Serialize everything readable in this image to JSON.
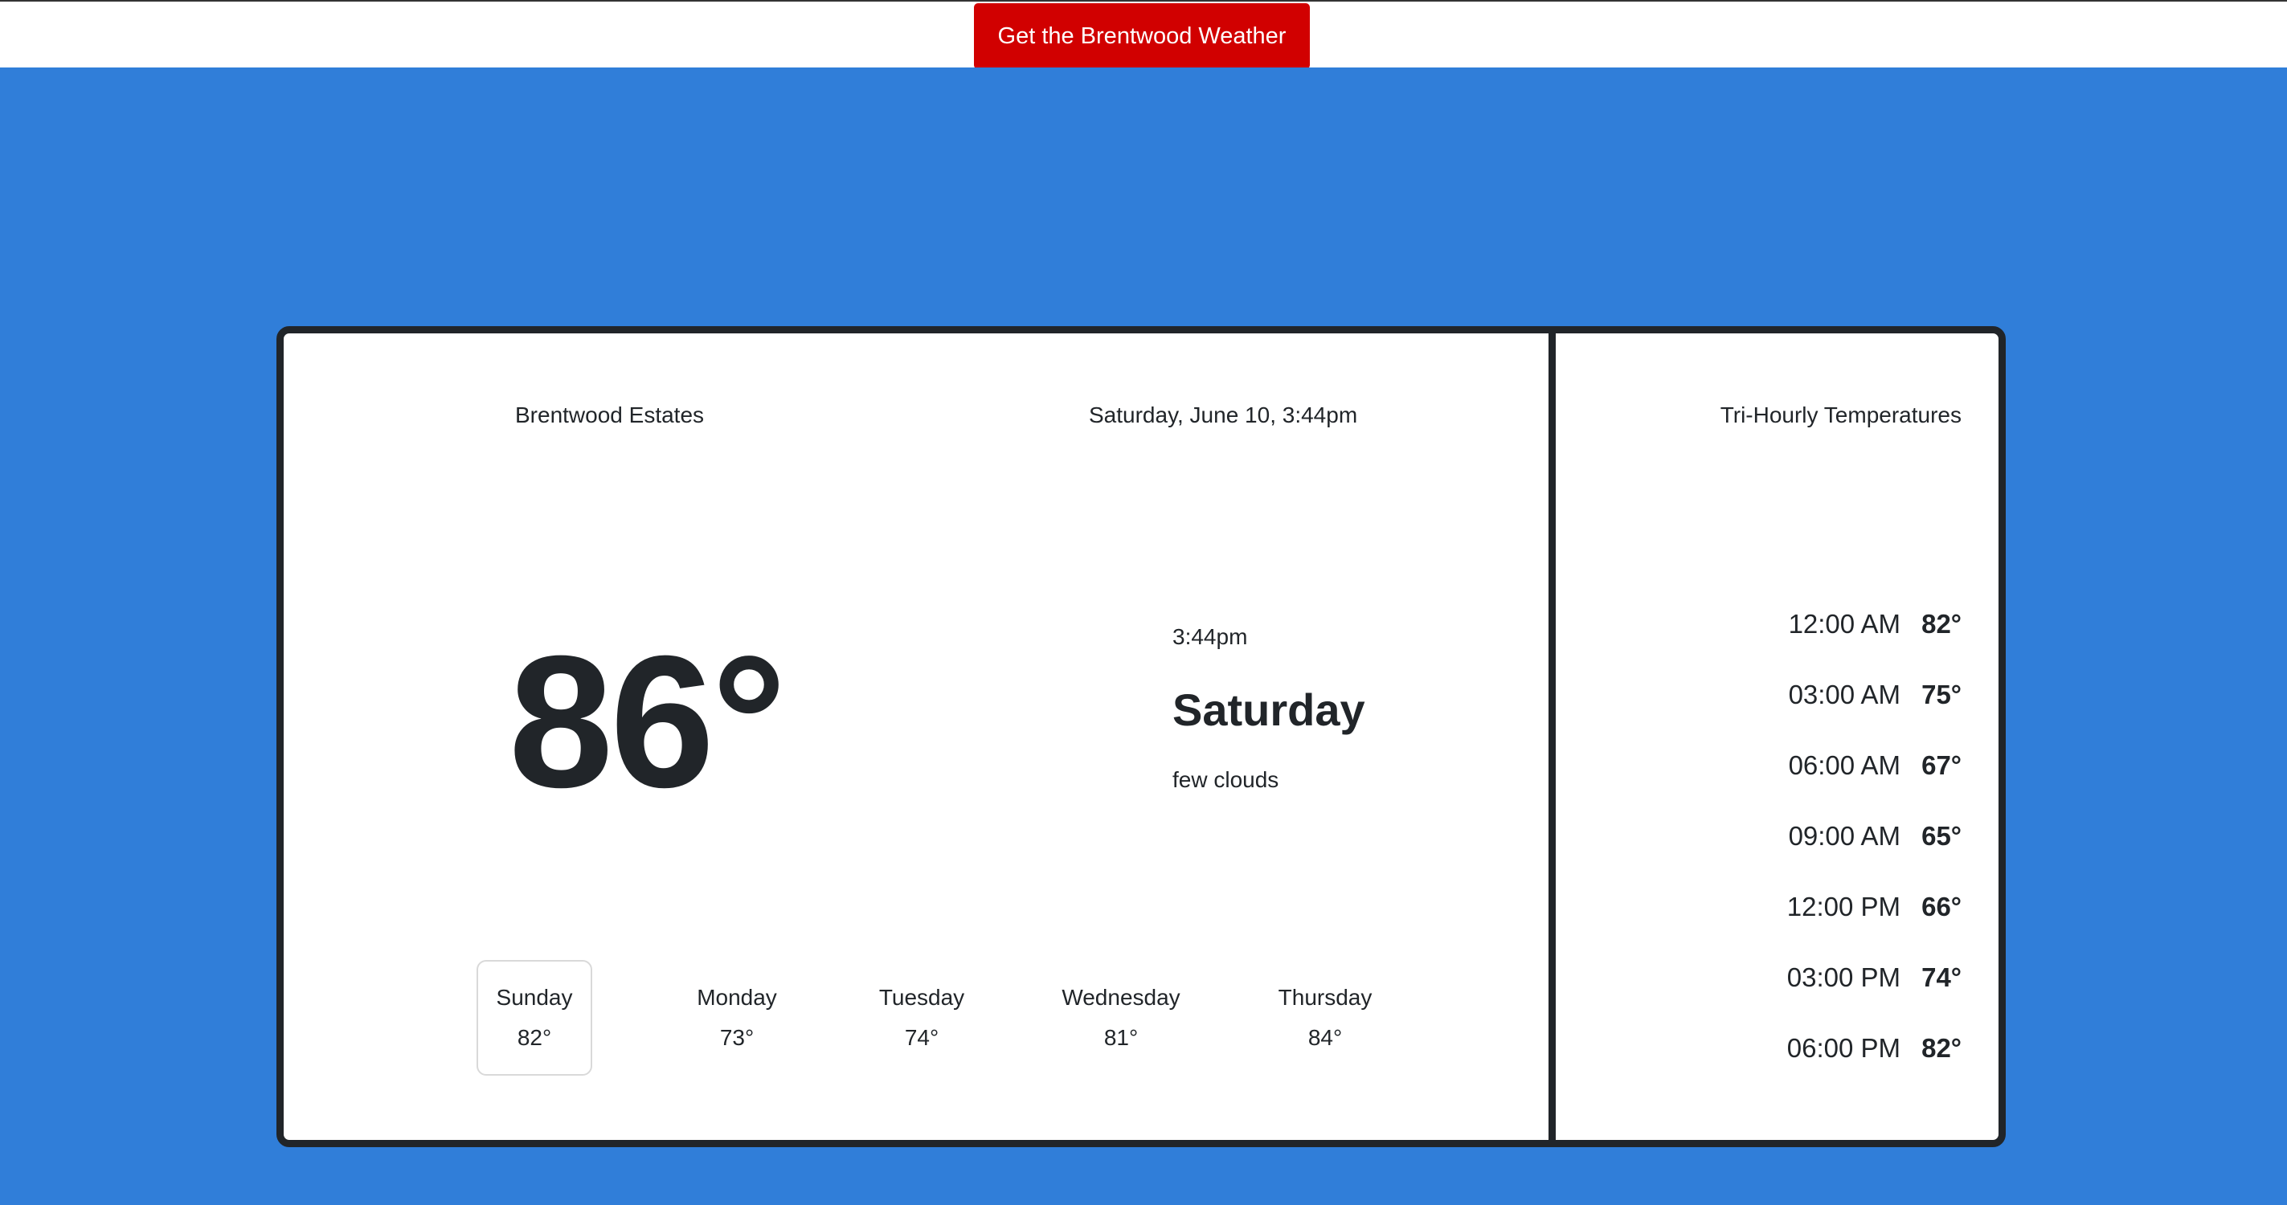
{
  "header": {
    "button_label": "Get the Brentwood Weather",
    "button_color": "#d10000"
  },
  "background_color": "#307ed9",
  "current": {
    "location": "Brentwood Estates",
    "datetime": "Saturday, June 10, 3:44pm",
    "temperature": "86°",
    "time": "3:44pm",
    "day": "Saturday",
    "condition": "few clouds"
  },
  "forecast": [
    {
      "day": "Sunday",
      "temp": "82°",
      "selected": true
    },
    {
      "day": "Monday",
      "temp": "73°"
    },
    {
      "day": "Tuesday",
      "temp": "74°"
    },
    {
      "day": "Wednesday",
      "temp": "81°"
    },
    {
      "day": "Thursday",
      "temp": "84°"
    }
  ],
  "tri_hourly": {
    "title": "Tri-Hourly Temperatures",
    "items": [
      {
        "time": "12:00 AM",
        "temp": "82°"
      },
      {
        "time": "03:00 AM",
        "temp": "75°"
      },
      {
        "time": "06:00 AM",
        "temp": "67°"
      },
      {
        "time": "09:00 AM",
        "temp": "65°"
      },
      {
        "time": "12:00 PM",
        "temp": "66°"
      },
      {
        "time": "03:00 PM",
        "temp": "74°"
      },
      {
        "time": "06:00 PM",
        "temp": "82°"
      }
    ]
  }
}
